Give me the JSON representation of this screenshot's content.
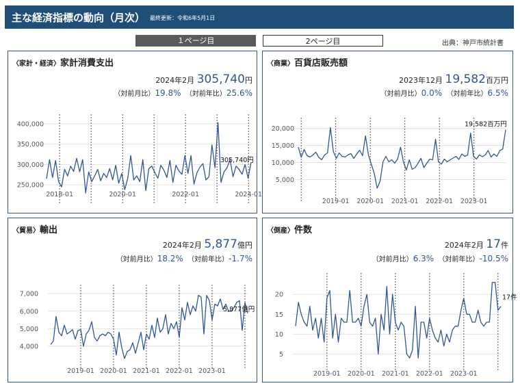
{
  "header": {
    "title": "主な経済指標の動向（月次）",
    "updated": "最終更新：令和6年5月1日"
  },
  "tabs": [
    {
      "label": "１ページ目"
    },
    {
      "label": "2ページ目"
    }
  ],
  "source": "出典：神戸市統計書",
  "colors": {
    "header_bg": "#1f4e79",
    "line": "#2f5597",
    "value": "#2f5597"
  },
  "panels": [
    {
      "category": "〈家計・経済〉",
      "title": "家計消費支出",
      "period": "2024年2月",
      "value": "305,740",
      "unit": "円",
      "mom_label": "（対前月比）",
      "mom": "19.8%",
      "yoy_label": "（対前年比）",
      "yoy": "25.6%",
      "end_label": "305,740円"
    },
    {
      "category": "〈商業〉",
      "title": "百貨店販売額",
      "period": "2023年12月",
      "value": "19,582",
      "unit": "百万円",
      "mom_label": "（対前月比）",
      "mom": "0.0%",
      "yoy_label": "（対前年比）",
      "yoy": "6.5%",
      "end_label": "19,582百万円"
    },
    {
      "category": "〈貿易〉",
      "title": "輸出",
      "period": "2024年2月",
      "value": "5,877",
      "unit": "億円",
      "mom_label": "（対前月比）",
      "mom": "18.2%",
      "yoy_label": "（対前年比）",
      "yoy": "-1.7%",
      "end_label": "5,877億円"
    },
    {
      "category": "〈倒産〉",
      "title": "件数",
      "period": "2024年2月",
      "value": "17",
      "unit": "件",
      "mom_label": "（対前月比）",
      "mom": "6.3%",
      "yoy_label": "（対前年比）",
      "yoy": "-10.5%",
      "end_label": "17件"
    }
  ],
  "chart_data": [
    {
      "type": "line",
      "start": "2017-08",
      "end": "2024-02",
      "yticks": [
        250000,
        300000,
        350000,
        400000
      ],
      "ytick_labels": [
        "250,000",
        "300,000",
        "350,000",
        "400,000"
      ],
      "ylim": [
        225000,
        410000
      ],
      "xtick_labels": [
        "2018-01",
        "2020-01",
        "2022-01",
        "2024-01"
      ],
      "xtick_dates": [
        "2018-01",
        "2020-01",
        "2022-01",
        "2024-01"
      ],
      "year_lines": [
        "2018-01",
        "2019-01",
        "2020-01",
        "2021-01",
        "2022-01",
        "2023-01",
        "2024-01"
      ],
      "values": [
        265000,
        312000,
        268000,
        310000,
        258000,
        245000,
        288000,
        272000,
        296000,
        283000,
        315000,
        282000,
        312000,
        230000,
        282000,
        258000,
        272000,
        288000,
        260000,
        278000,
        268000,
        290000,
        262000,
        298000,
        254000,
        278000,
        238000,
        266000,
        322000,
        262000,
        272000,
        258000,
        312000,
        236000,
        290000,
        296000,
        280000,
        266000,
        298000,
        286000,
        268000,
        310000,
        256000,
        298000,
        284000,
        276000,
        322000,
        278000,
        322000,
        252000,
        280000,
        294000,
        302000,
        262000,
        270000,
        348000,
        292000,
        403000,
        256000,
        282000,
        292000,
        312000,
        270000,
        296000,
        288000,
        276000,
        300000,
        266000,
        305740
      ]
    },
    {
      "type": "line",
      "start": "2017-12",
      "end": "2023-12",
      "yticks": [
        5000,
        10000,
        15000,
        20000
      ],
      "ytick_labels": [
        "5,000",
        "10,000",
        "15,000",
        "20,000"
      ],
      "ylim": [
        1500,
        21500
      ],
      "xtick_labels": [
        "2019-01",
        "2020-01",
        "2021-01",
        "2022-01",
        "2023-01"
      ],
      "xtick_dates": [
        "2019-01",
        "2020-01",
        "2021-01",
        "2022-01",
        "2023-01"
      ],
      "year_lines": [
        "2018-01",
        "2019-01",
        "2020-01",
        "2021-01",
        "2022-01",
        "2023-01"
      ],
      "values": [
        14500,
        11500,
        13800,
        12000,
        11600,
        12200,
        13000,
        11500,
        10800,
        12200,
        12800,
        20200,
        13200,
        11200,
        12800,
        11800,
        11600,
        12200,
        12600,
        11200,
        12500,
        13600,
        12000,
        17800,
        12200,
        9500,
        6800,
        2500,
        4500,
        10200,
        11800,
        10200,
        10800,
        9800,
        11000,
        14500,
        10200,
        7800,
        10800,
        8000,
        8500,
        9800,
        11200,
        8500,
        9800,
        11000,
        10800,
        16800,
        10200,
        9500,
        11000,
        10200,
        10800,
        11300,
        11800,
        10900,
        12500,
        11800,
        12200,
        18600,
        11800,
        11000,
        12200,
        11700,
        12200,
        13500,
        11600,
        12500,
        11800,
        13500,
        13900,
        19582
      ]
    },
    {
      "type": "line",
      "start": "2018-02",
      "end": "2024-02",
      "yticks": [
        4000,
        5000,
        6000,
        7000
      ],
      "ytick_labels": [
        "4,000",
        "5,000",
        "6,000",
        "7,000"
      ],
      "ylim": [
        3300,
        7200
      ],
      "xtick_labels": [
        "2019-01",
        "2020-01",
        "2021-01",
        "2022-01",
        "2023-01"
      ],
      "xtick_dates": [
        "2019-01",
        "2020-01",
        "2021-01",
        "2022-01",
        "2023-01"
      ],
      "year_lines": [
        "2019-01",
        "2020-01",
        "2021-01",
        "2022-01",
        "2023-01",
        "2024-01"
      ],
      "values": [
        4100,
        4300,
        5700,
        4800,
        4600,
        5200,
        4700,
        4800,
        4950,
        4400,
        4900,
        4950,
        4000,
        4700,
        4900,
        5400,
        4500,
        4300,
        4600,
        4700,
        4600,
        4800,
        4700,
        4400,
        3500,
        4800,
        3900,
        3300,
        3700,
        3800,
        4200,
        3600,
        4200,
        4800,
        3800,
        4700,
        4400,
        5200,
        4500,
        5600,
        4800,
        5000,
        5800,
        4700,
        5300,
        5000,
        5400,
        4500,
        6200,
        5500,
        6500,
        5800,
        6300,
        6000,
        6900,
        6800,
        4700,
        6900,
        6600,
        5500,
        6400,
        6300,
        6700,
        6100,
        6400,
        6000,
        6000,
        6200,
        6500,
        6600,
        4900,
        6500,
        5877
      ]
    },
    {
      "type": "line",
      "start": "2018-02",
      "end": "2024-02",
      "yticks": [
        5,
        10,
        15,
        20
      ],
      "ytick_labels": [
        "5",
        "10",
        "15",
        "20"
      ],
      "ylim": [
        3,
        24
      ],
      "xtick_labels": [
        "2019-01",
        "2020-01",
        "2021-01",
        "2022-01",
        "2023-01"
      ],
      "xtick_dates": [
        "2019-01",
        "2020-01",
        "2021-01",
        "2022-01",
        "2023-01"
      ],
      "year_lines": [
        "2019-01",
        "2020-01",
        "2021-01",
        "2022-01",
        "2023-01",
        "2024-01"
      ],
      "values": [
        12,
        18,
        15,
        13,
        12,
        17,
        11,
        14,
        9,
        14,
        8,
        19,
        21,
        9,
        15,
        8,
        14,
        13,
        13,
        21,
        13,
        13,
        14,
        12,
        17,
        20,
        13,
        12,
        14,
        5,
        15,
        11,
        22,
        10,
        20,
        13,
        11,
        13,
        12,
        5,
        4,
        6,
        17,
        4,
        13,
        13,
        9,
        14,
        11,
        9,
        8,
        11,
        7,
        10,
        8,
        11,
        12,
        12,
        16,
        19,
        15,
        15,
        13,
        13,
        16,
        13,
        12,
        13,
        13,
        23,
        23,
        16,
        17
      ]
    }
  ]
}
